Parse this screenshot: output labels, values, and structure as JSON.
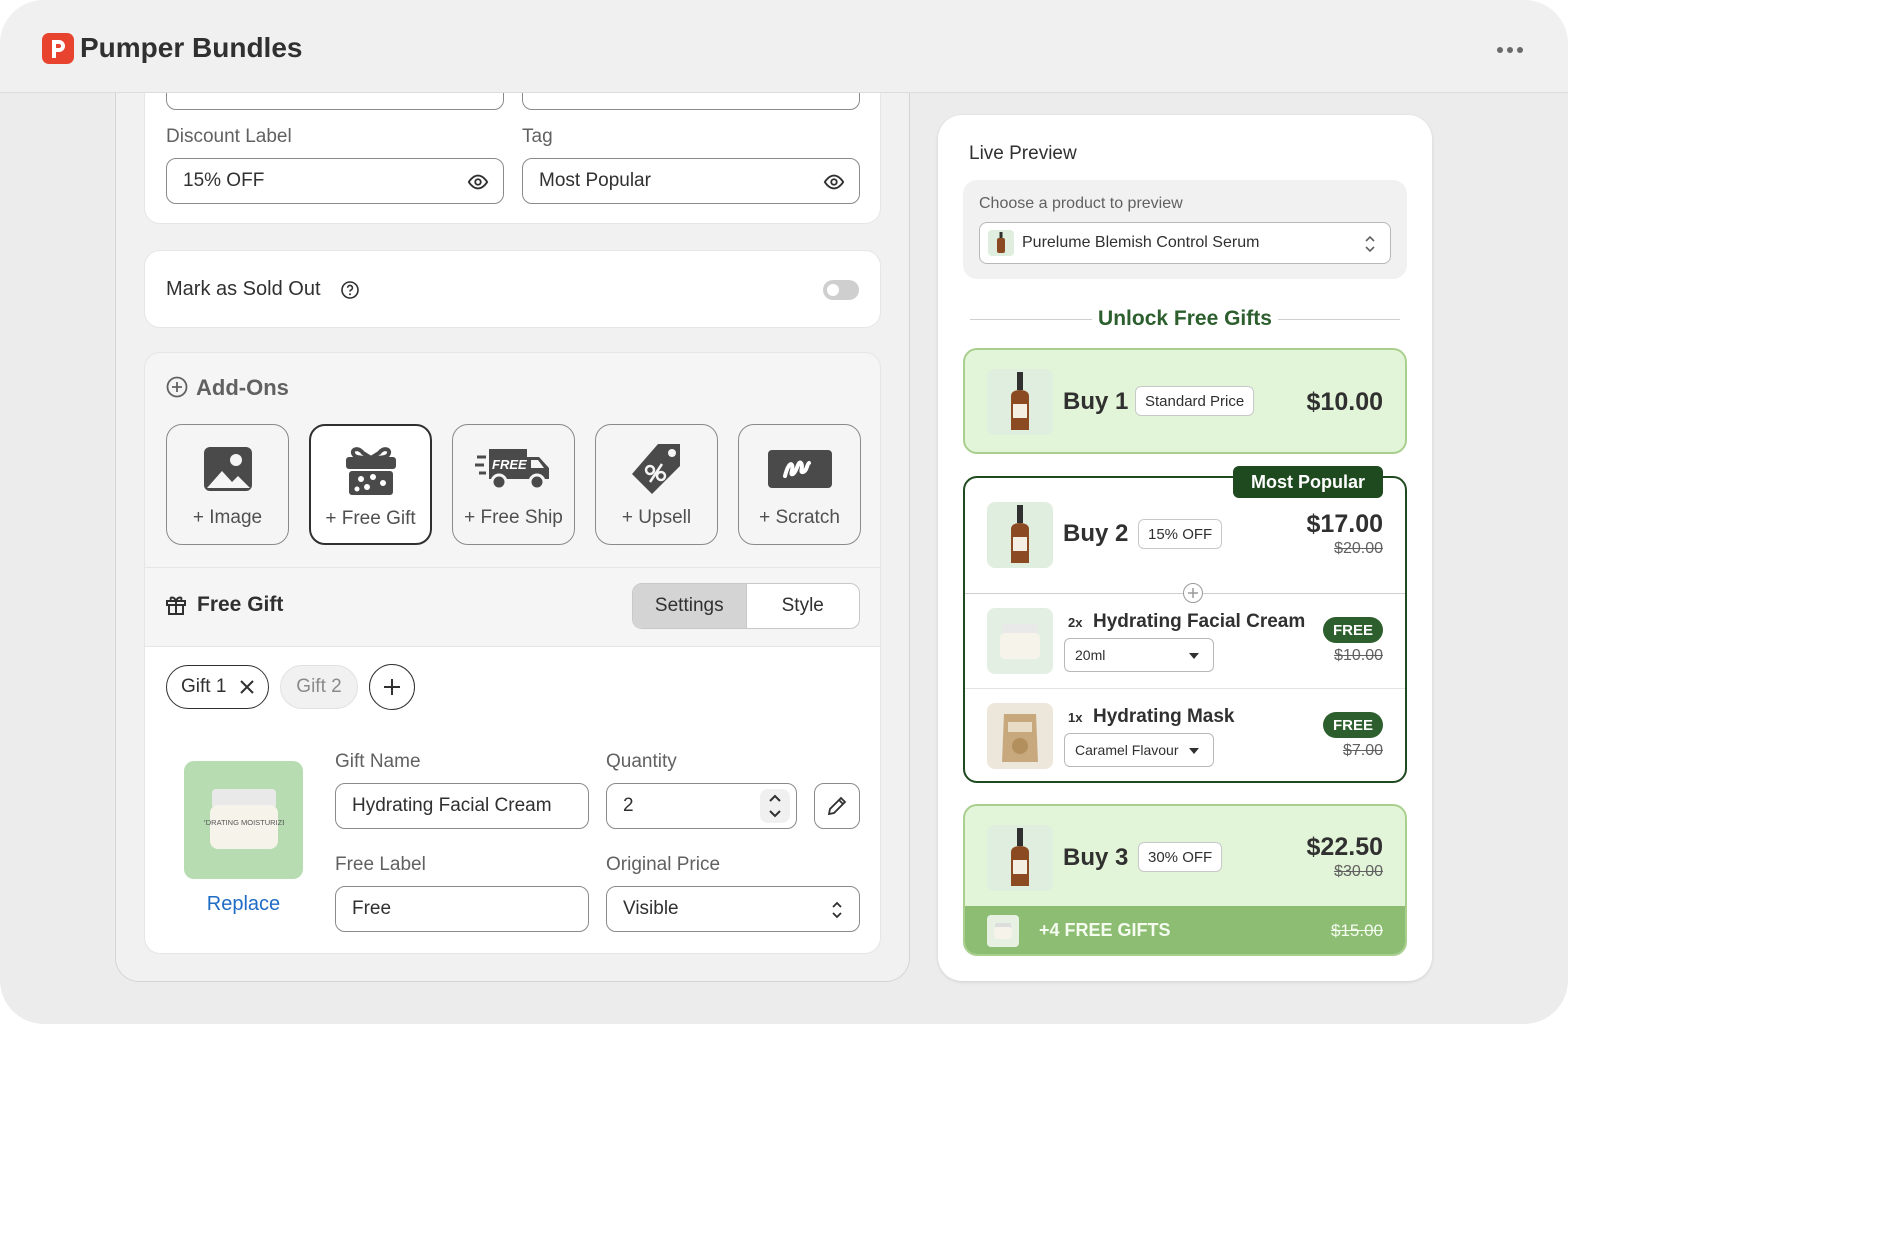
{
  "app": {
    "title": "Pumper Bundles",
    "logo_letter": "P"
  },
  "form": {
    "discount_label": {
      "label": "Discount Label",
      "value": "15% OFF"
    },
    "tag": {
      "label": "Tag",
      "value": "Most Popular"
    },
    "sold_out": {
      "label": "Mark as Sold Out",
      "enabled": false
    }
  },
  "addons": {
    "title": "Add-Ons",
    "items": [
      {
        "label": "+ Image",
        "icon": "image-icon"
      },
      {
        "label": "+ Free Gift",
        "icon": "gift-box-icon",
        "selected": true
      },
      {
        "label": "+ Free Ship",
        "icon": "free-shipping-truck-icon",
        "icon_text": "FREE"
      },
      {
        "label": "+ Upsell",
        "icon": "percent-tag-icon"
      },
      {
        "label": "+ Scratch",
        "icon": "scratch-card-icon"
      }
    ]
  },
  "free_gift": {
    "title": "Free Gift",
    "tabs": [
      "Settings",
      "Style"
    ],
    "active_tab": "Settings",
    "gift_chips": [
      "Gift 1",
      "Gift 2"
    ],
    "replace_label": "Replace",
    "image_text": "HYDRATING MOISTURIZER",
    "gift_name": {
      "label": "Gift Name",
      "value": "Hydrating Facial Cream"
    },
    "quantity": {
      "label": "Quantity",
      "value": "2"
    },
    "free_label": {
      "label": "Free Label",
      "value": "Free"
    },
    "original_price": {
      "label": "Original Price",
      "value": "Visible"
    }
  },
  "preview": {
    "title": "Live Preview",
    "chooser_label": "Choose a product to preview",
    "selected_product": "Purelume Blemish Control Serum",
    "heading": "Unlock Free Gifts",
    "offers": [
      {
        "buy": "Buy 1",
        "badge": "Standard Price",
        "price": "$10.00"
      },
      {
        "buy": "Buy 2",
        "badge": "15% OFF",
        "price": "$17.00",
        "original": "$20.00",
        "ribbon": "Most Popular",
        "gifts": [
          {
            "qty": "2x",
            "name": "Hydrating Facial Cream",
            "variant": "20ml",
            "free": "FREE",
            "original": "$10.00"
          },
          {
            "qty": "1x",
            "name": "Hydrating Mask",
            "variant": "Caramel Flavour",
            "free": "FREE",
            "original": "$7.00"
          }
        ]
      },
      {
        "buy": "Buy 3",
        "badge": "30% OFF",
        "price": "$22.50",
        "original": "$30.00",
        "footer": {
          "text": "+4 FREE GIFTS",
          "original": "$15.00"
        }
      }
    ]
  },
  "colors": {
    "brand_red": "#e8432f",
    "green_dark": "#2c5f2d",
    "green_light": "#e3f5d8",
    "green_mid": "#a9cf8f"
  }
}
